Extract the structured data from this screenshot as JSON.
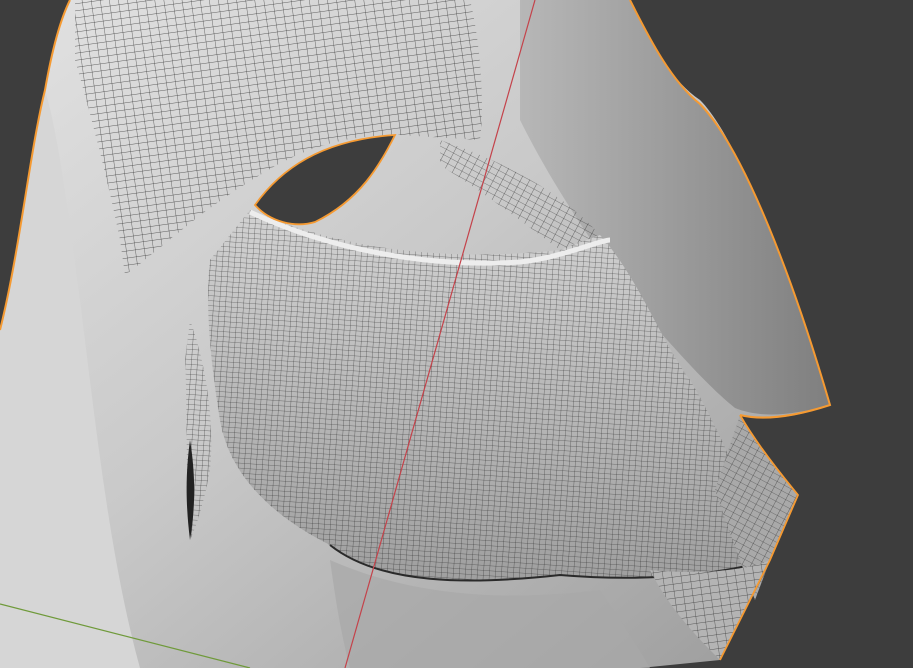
{
  "app": {
    "name": "",
    "view_label": ""
  },
  "viewport": {
    "background_color": "#3d3d3d",
    "mesh_base_color": "#bdbdbd",
    "mesh_light_color": "#d8d8d8",
    "mesh_shadow_color": "#8c8c8c",
    "selection_outline_color": "#f59a32",
    "wireframe_color": "#1a1a1a",
    "x_axis_color": "#c4424a",
    "y_axis_color": "#6f9a3a"
  },
  "objects": [
    {
      "name": "",
      "state": "selected",
      "icon": "mesh-object-icon"
    }
  ]
}
